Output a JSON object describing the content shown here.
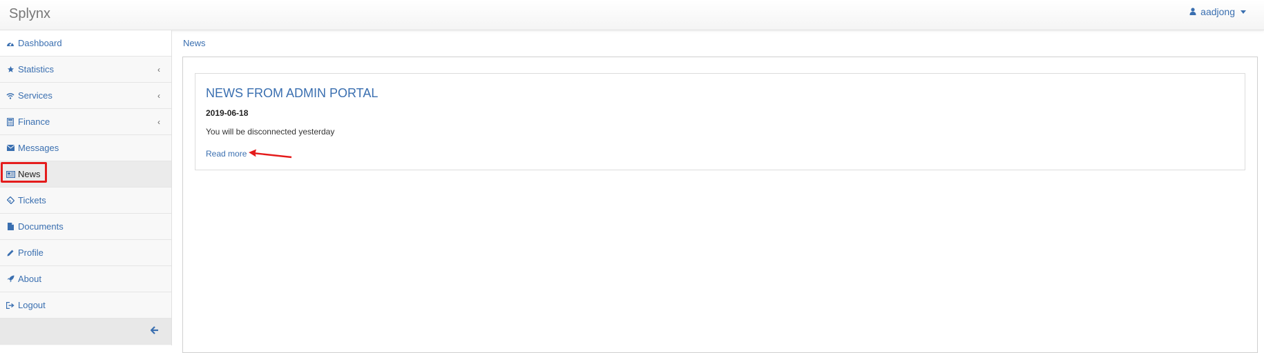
{
  "app": {
    "brand": "Splynx",
    "user": "aadjong"
  },
  "sidebar": {
    "items": [
      {
        "label": "Dashboard",
        "icon": "dashboard-icon"
      },
      {
        "label": "Statistics",
        "icon": "star-icon"
      },
      {
        "label": "Services",
        "icon": "wifi-icon"
      },
      {
        "label": "Finance",
        "icon": "calculator-icon"
      },
      {
        "label": "Messages",
        "icon": "envelope-icon"
      },
      {
        "label": "News",
        "icon": "newspaper-icon"
      },
      {
        "label": "Tickets",
        "icon": "ticket-icon"
      },
      {
        "label": "Documents",
        "icon": "file-icon"
      },
      {
        "label": "Profile",
        "icon": "pencil-icon"
      },
      {
        "label": "About",
        "icon": "rocket-icon"
      },
      {
        "label": "Logout",
        "icon": "sign-out-icon"
      }
    ],
    "collapse_icon": "arrow-left-icon"
  },
  "breadcrumb": "News",
  "news": {
    "title": "NEWS FROM ADMIN PORTAL",
    "date": "2019-06-18",
    "text": "You will be disconnected yesterday",
    "read_more": "Read more"
  },
  "colors": {
    "link": "#3a6fb0",
    "highlight": "#e41b1b",
    "annotation_arrow": "#e41b1b"
  }
}
